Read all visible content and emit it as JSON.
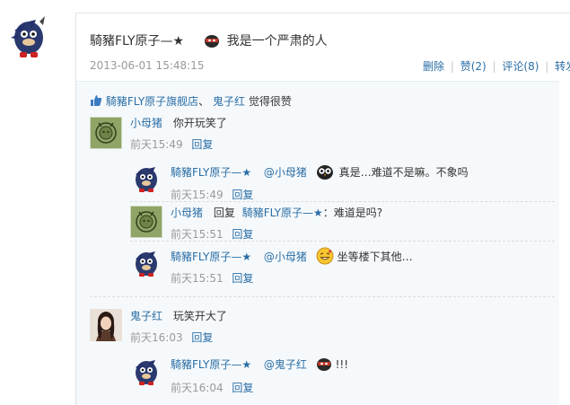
{
  "post": {
    "author": "騎豬FLY原子—★",
    "text": "我是一个严肃的人",
    "timestamp": "2013-06-01 15:48:15",
    "actions": {
      "delete": "删除",
      "like": "赞(2)",
      "comment": "评论(8)",
      "forward": "转发"
    }
  },
  "likes": {
    "user1": "騎豬FLY原子旗舰店",
    "sep": "、",
    "user2": "鬼子红",
    "suffix": "觉得很赞"
  },
  "comments": [
    {
      "author": "小母猪",
      "text": "你开玩笑了",
      "time": "前天15:49",
      "reply": "回复",
      "replies": [
        {
          "author": "騎豬FLY原子—★",
          "mention": "@小母猪",
          "text": "真是…难道不是嘛。不象吗",
          "time": "前天15:49",
          "reply": "回复"
        },
        {
          "author": "小母猪",
          "reply_word": "回复",
          "target": "騎豬FLY原子—★",
          "text": "：难道是吗?",
          "time": "前天15:51",
          "reply": "回复"
        },
        {
          "author": "騎豬FLY原子—★",
          "mention": "@小母猪",
          "text": "坐等楼下其他…",
          "time": "前天15:51",
          "reply": "回复"
        }
      ]
    },
    {
      "author": "鬼子红",
      "text": "玩笑开大了",
      "time": "前天16:03",
      "reply": "回复",
      "replies": [
        {
          "author": "騎豬FLY原子—★",
          "mention": "@鬼子红",
          "text": "!!!",
          "time": "前天16:04",
          "reply": "回复"
        }
      ]
    }
  ],
  "colors": {
    "link": "#2a6ea6",
    "time": "#999999",
    "reply_bg": "#f6f9fb"
  },
  "icons": [
    "sonic-avatar",
    "pig-avatar",
    "girl-avatar",
    "ninja-emoji",
    "owl-emoji",
    "grin-emoji",
    "thumb-up-icon"
  ]
}
